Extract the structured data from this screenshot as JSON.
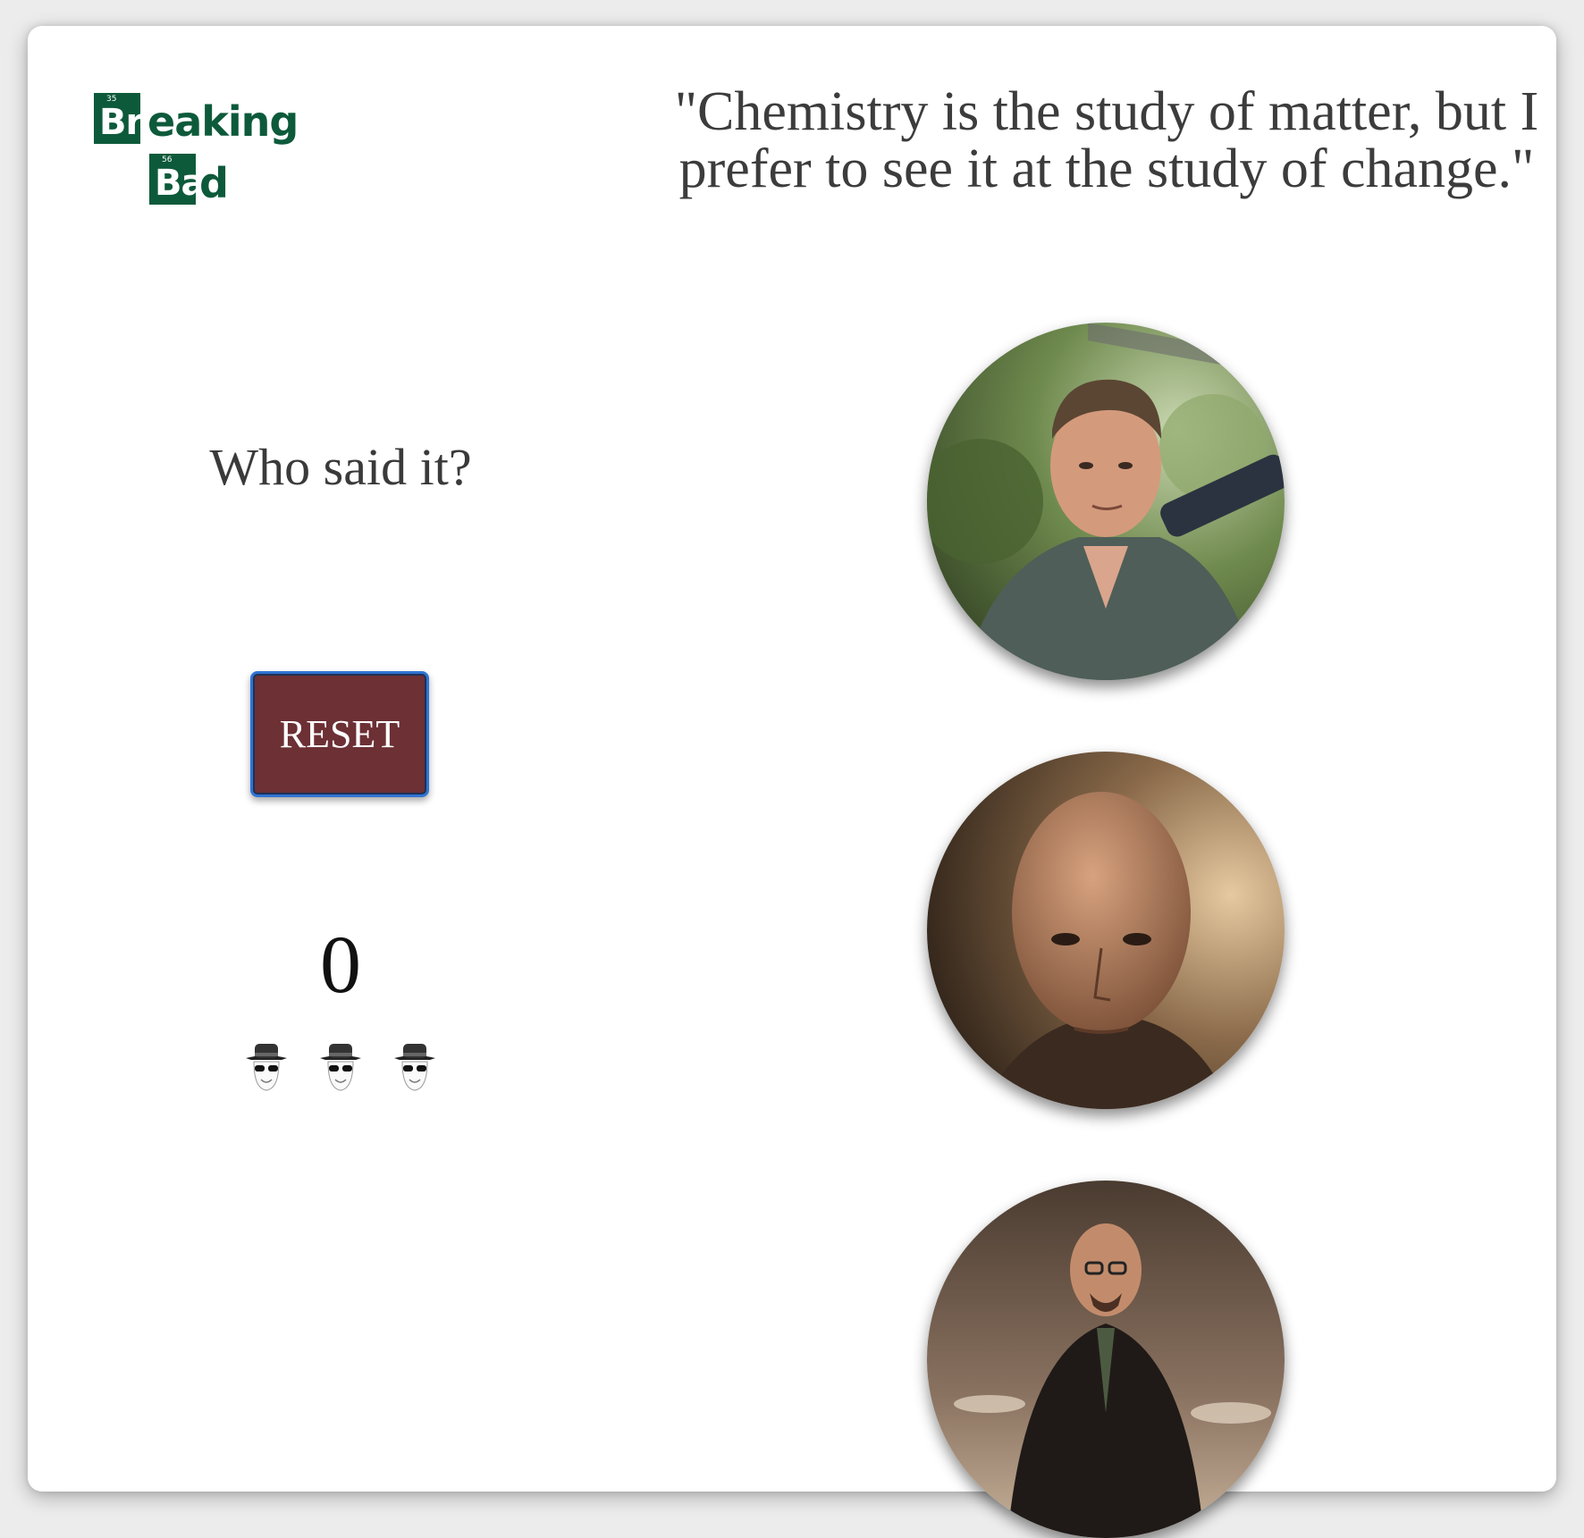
{
  "logo": {
    "alt": "Breaking Bad",
    "top": {
      "number": "35",
      "symbol": "Br",
      "rest": "eaking"
    },
    "bottom": {
      "number": "56",
      "symbol": "Ba",
      "rest": "d"
    }
  },
  "quote": {
    "text": "\"Chemistry is the study of matter, but I prefer to see it at the study of change.\""
  },
  "game": {
    "question": "Who said it?",
    "reset_label": "RESET",
    "score": "0",
    "lives_count": 3,
    "life_icon": "heisenberg-icon"
  },
  "characters": [
    {
      "id": "character-1",
      "icon": "character-portrait-rugged-man"
    },
    {
      "id": "character-2",
      "icon": "character-portrait-bald-man"
    },
    {
      "id": "character-3",
      "icon": "character-portrait-man-in-glasses"
    }
  ],
  "colors": {
    "logo_green": "#0d5a3b",
    "reset_bg": "#6c3035",
    "reset_border": "#2f74d4",
    "text": "#3c3c3c"
  }
}
